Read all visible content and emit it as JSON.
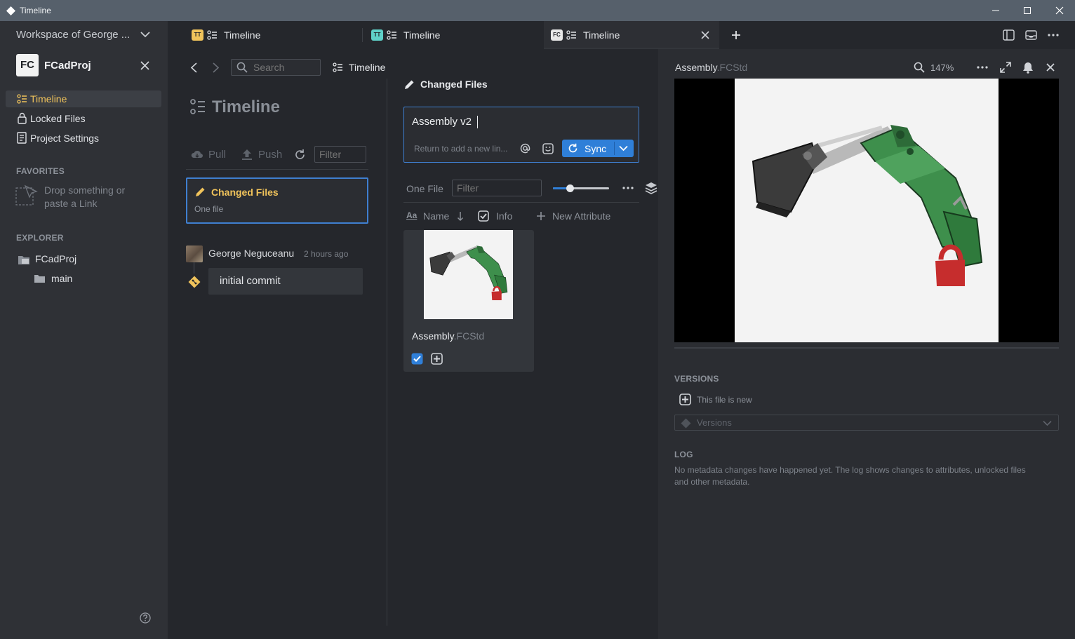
{
  "window": {
    "title": "Timeline"
  },
  "sidebar": {
    "workspace": "Workspace of George ...",
    "project_badge": "FC",
    "project_name": "FCadProj",
    "nav": [
      {
        "label": "Timeline",
        "icon": "timeline-icon",
        "active": true
      },
      {
        "label": "Locked Files",
        "icon": "lock-icon"
      },
      {
        "label": "Project Settings",
        "icon": "settings-doc-icon"
      }
    ],
    "favorites_heading": "FAVORITES",
    "drop_text_1": "Drop something or",
    "drop_text_2": "paste a Link",
    "explorer_heading": "EXPLORER",
    "explorer_root": "FCadProj",
    "explorer_child": "main"
  },
  "tabs": [
    {
      "badge": "TT",
      "badge_color": "#f0c35b",
      "label": "Timeline"
    },
    {
      "badge": "TT",
      "badge_color": "#5fd0c8",
      "label": "Timeline"
    },
    {
      "badge": "FC",
      "badge_color": "#e8e8e8",
      "label": "Timeline",
      "active": true
    }
  ],
  "breadcrumb": {
    "search_placeholder": "Search",
    "current": "Timeline"
  },
  "timeline": {
    "title": "Timeline",
    "pull": "Pull",
    "push": "Push",
    "filter_placeholder": "Filter",
    "changed_card_title": "Changed Files",
    "changed_card_sub": "One file",
    "author": "George Neguceanu",
    "time": "2 hours ago",
    "commit_message": "initial commit"
  },
  "changes": {
    "header": "Changed Files",
    "commit_input": "Assembly v2",
    "hint": "Return to add a new lin...",
    "sync": "Sync",
    "count": "One File",
    "filter_placeholder": "Filter",
    "zoom_fraction": 0.3,
    "col_name": "Name",
    "col_info": "Info",
    "new_attribute": "New Attribute",
    "file_base": "Assembly",
    "file_ext": ".FCStd"
  },
  "viewer": {
    "file_base": "Assembly",
    "file_ext": ".FCStd",
    "zoom": "147%",
    "versions_heading": "VERSIONS",
    "new_file": "This file is new",
    "versions_placeholder": "Versions",
    "log_heading": "LOG",
    "log_text_1": "No metadata changes have happened yet. The log shows changes to attributes, unlocked files",
    "log_text_2": "and other metadata."
  },
  "colors": {
    "accent": "#3f7fd0",
    "active_nav": "#f0c35b",
    "model_green": "#3e8f4c",
    "lock_red": "#c62d2d"
  }
}
